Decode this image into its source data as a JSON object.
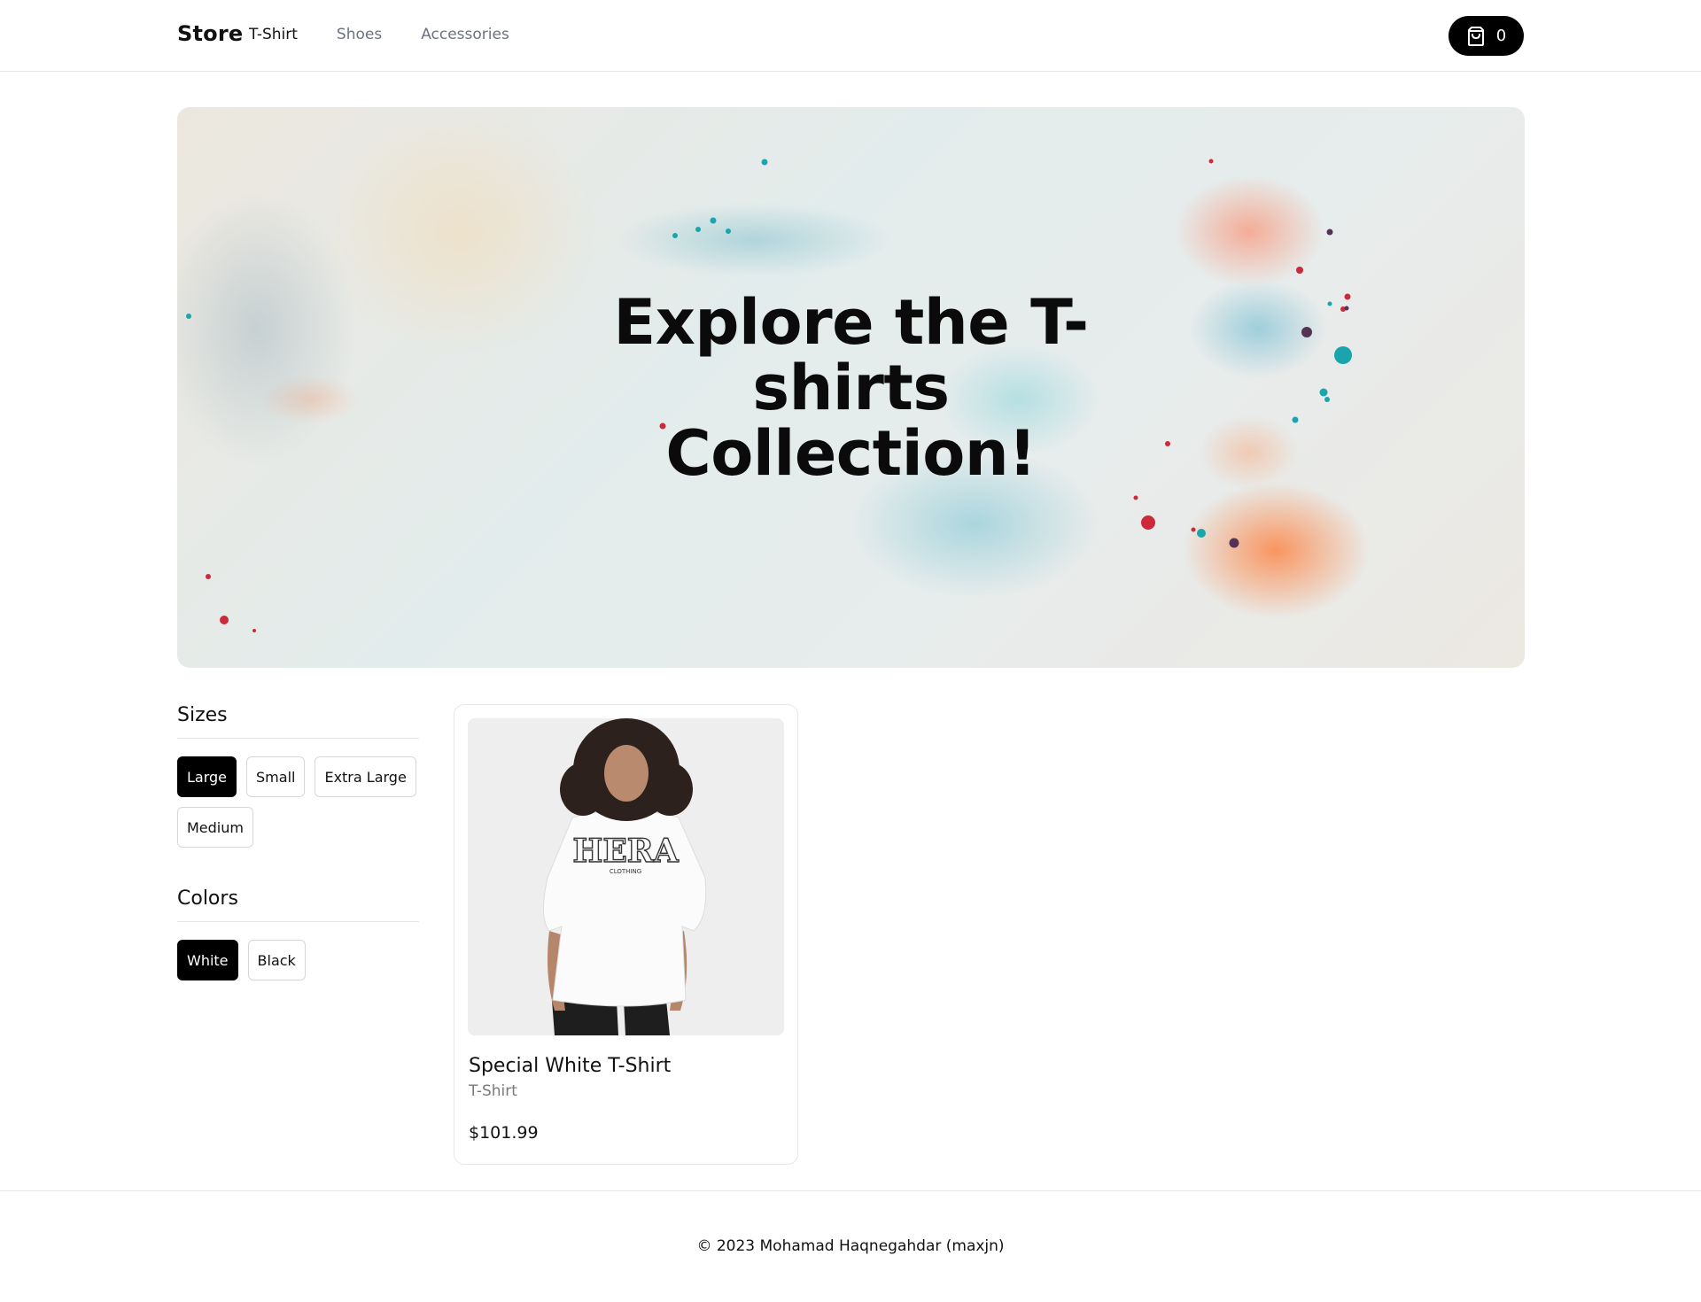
{
  "header": {
    "brand": "Store",
    "nav": [
      {
        "label": "T-Shirt",
        "active": true
      },
      {
        "label": "Shoes",
        "active": false
      },
      {
        "label": "Accessories",
        "active": false
      }
    ],
    "cart": {
      "icon": "shopping-bag-icon",
      "count": "0"
    }
  },
  "hero": {
    "title": "Explore the T-shirts Collection!"
  },
  "filters": {
    "sizes": {
      "title": "Sizes",
      "options": [
        {
          "label": "Large",
          "selected": true
        },
        {
          "label": "Small",
          "selected": false
        },
        {
          "label": "Extra Large",
          "selected": false
        },
        {
          "label": "Medium",
          "selected": false
        }
      ]
    },
    "colors": {
      "title": "Colors",
      "options": [
        {
          "label": "White",
          "selected": true
        },
        {
          "label": "Black",
          "selected": false
        }
      ]
    }
  },
  "products": [
    {
      "name": "Special White T-Shirt",
      "category": "T-Shirt",
      "price": "$101.99",
      "image_text": "HERA",
      "image_subtext": "CLOTHING"
    }
  ],
  "footer": {
    "text": "© 2023 Mohamad Haqnegahdar (maxjn)"
  },
  "colors": {
    "accent": "#000000",
    "background": "#ffffff",
    "muted_text": "#6b7280",
    "border": "#e5e7eb"
  }
}
